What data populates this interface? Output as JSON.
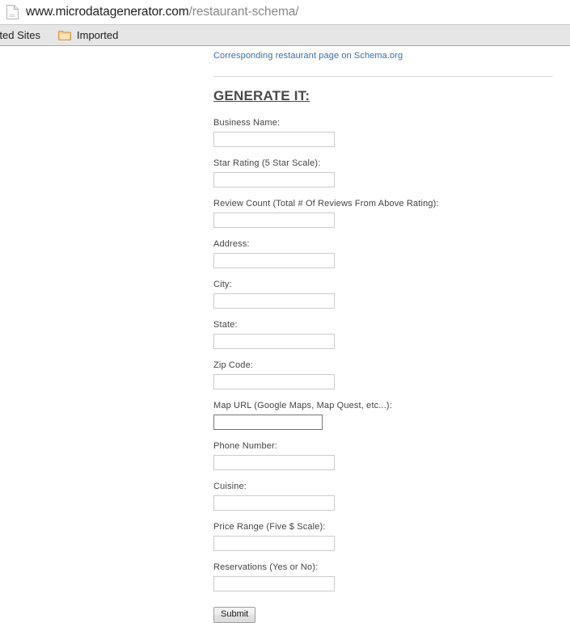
{
  "browser": {
    "url": {
      "icon": "page-document-icon",
      "host": "www.microdatagenerator.com",
      "path": "/restaurant-schema/"
    },
    "bookmarks": [
      {
        "label": "uggested Sites",
        "icon": "none"
      },
      {
        "label": "Imported",
        "icon": "folder-icon"
      }
    ]
  },
  "page": {
    "schema_link": "Corresponding restaurant page on Schema.org",
    "heading": "GENERATE IT:",
    "fields": [
      {
        "label": "Business Name:",
        "value": "",
        "name": "business-name",
        "focused": false
      },
      {
        "label": "Star Rating (5 Star Scale):",
        "value": "",
        "name": "star-rating",
        "focused": false
      },
      {
        "label": "Review Count (Total # Of Reviews From Above Rating):",
        "value": "",
        "name": "review-count",
        "focused": false
      },
      {
        "label": "Address:",
        "value": "",
        "name": "address",
        "focused": false
      },
      {
        "label": "City:",
        "value": "",
        "name": "city",
        "focused": false
      },
      {
        "label": "State:",
        "value": "",
        "name": "state",
        "focused": false
      },
      {
        "label": "Zip Code:",
        "value": "",
        "name": "zip-code",
        "focused": false
      },
      {
        "label": "Map URL (Google Maps, Map Quest, etc...):",
        "value": "",
        "name": "map-url",
        "focused": true
      },
      {
        "label": "Phone Number:",
        "value": "",
        "name": "phone-number",
        "focused": false
      },
      {
        "label": "Cuisine:",
        "value": "",
        "name": "cuisine",
        "focused": false
      },
      {
        "label": "Price Range (Five $ Scale):",
        "value": "",
        "name": "price-range",
        "focused": false
      },
      {
        "label": "Reservations (Yes or No):",
        "value": "",
        "name": "reservations",
        "focused": false
      }
    ],
    "submit_label": "Submit"
  },
  "colors": {
    "link": "#3c6ea5",
    "heading": "#4a4a4a",
    "label": "#444444",
    "input_border": "#cccccc",
    "input_border_focused": "#767676",
    "bookmarks_bar": "#e6e6e6",
    "folder_icon": "#f0c07a"
  }
}
